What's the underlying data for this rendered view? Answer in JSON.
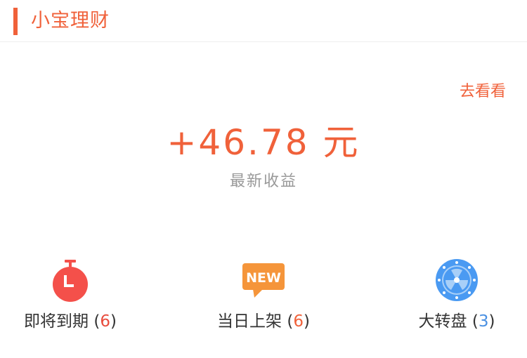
{
  "header": {
    "title": "小宝理财"
  },
  "summary": {
    "more_link": "去看看",
    "amount": "+46.78 元",
    "amount_label": "最新收益"
  },
  "items": [
    {
      "label": "即将到期",
      "open": " (",
      "count": "6",
      "close": ")",
      "icon": "stopwatch-icon",
      "count_color": "#e84c3d"
    },
    {
      "label": "当日上架",
      "open": " (",
      "count": "6",
      "close": ")",
      "icon": "new-badge-icon",
      "count_color": "#f0613a"
    },
    {
      "label": "大转盘",
      "open": " (",
      "count": "3",
      "close": ")",
      "icon": "wheel-icon",
      "count_color": "#4a90e2"
    }
  ],
  "colors": {
    "accent": "#f0613a",
    "timer_red": "#f4504a",
    "new_orange": "#f5953a",
    "wheel_blue": "#4a9af2"
  }
}
